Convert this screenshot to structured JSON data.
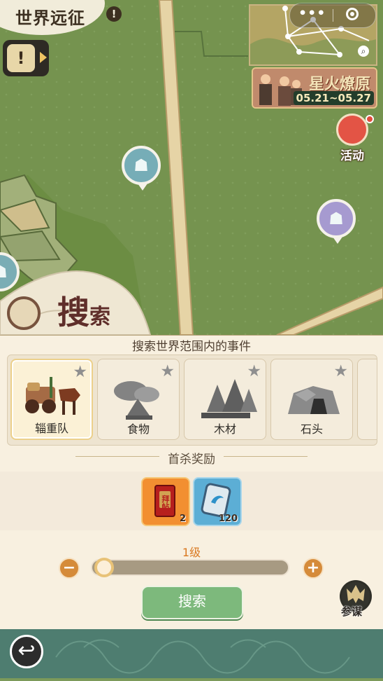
{
  "header": {
    "title": "世界远征",
    "info_icon": "info-icon"
  },
  "top_right": {
    "menu": "•••",
    "menu_icon": "more-dots-icon",
    "target_icon": "target-circle-icon",
    "search_icon": "search-icon"
  },
  "event_banner": {
    "title": "星火燎原",
    "date": "05.21~05.27"
  },
  "activity": {
    "label": "活动",
    "icon": "gift-box-icon"
  },
  "map": {
    "markers": [
      {
        "name": "map-marker-cyan",
        "icon": "scroll-icon"
      },
      {
        "name": "map-marker-purple",
        "icon": "scroll-icon"
      }
    ],
    "search_banner": {
      "big": "搜",
      "small": "索"
    }
  },
  "panel": {
    "title": "搜索世界范围内的事件",
    "events": [
      {
        "label": "辎重队",
        "selected": true
      },
      {
        "label": "食物",
        "selected": false
      },
      {
        "label": "木材",
        "selected": false
      },
      {
        "label": "石头",
        "selected": false
      }
    ]
  },
  "reward": {
    "title": "首杀奖励",
    "items": [
      {
        "name": "拜帖",
        "count": "2"
      },
      {
        "name": "",
        "count": "120"
      }
    ]
  },
  "level": {
    "label": "1级",
    "value": 1
  },
  "controls": {
    "minus": "−",
    "plus": "+",
    "search_button": "搜索",
    "advisor_label": "参谋"
  },
  "footer": {
    "back_icon": "back-arrow-icon"
  },
  "colors": {
    "map_green": "#75934f",
    "panel_bg": "#f8f0e0",
    "accent_orange": "#d97820",
    "button_green": "#7db97c",
    "bottom_teal": "#4e7d70"
  }
}
